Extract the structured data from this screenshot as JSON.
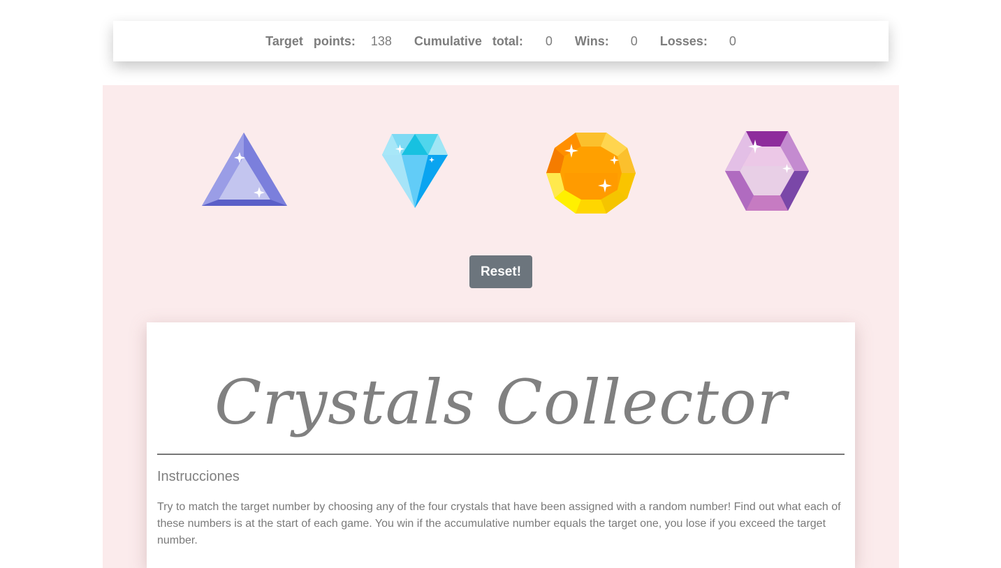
{
  "scoreboard": {
    "target_label": "Target points:",
    "target_value": "138",
    "cumulative_label": "Cumulative total:",
    "cumulative_value": "0",
    "wins_label": "Wins:",
    "wins_value": "0",
    "losses_label": "Losses:",
    "losses_value": "0"
  },
  "crystals": [
    {
      "icon": "triangle-crystal-icon",
      "color": "#8b8fd9"
    },
    {
      "icon": "diamond-crystal-icon",
      "color": "#5ec8f2"
    },
    {
      "icon": "orange-round-crystal-icon",
      "color": "#f5a623"
    },
    {
      "icon": "purple-hexagon-crystal-icon",
      "color": "#a45fb5"
    }
  ],
  "reset_label": "Reset!",
  "card": {
    "title": "Crystals Collector",
    "subheading": "Instrucciones",
    "instructions": "Try to match the target number by choosing any of the four crystals that have been assigned with a random number! Find out what each of these numbers is at the start of each game. You win if the accumulative number equals the target one, you lose if you exceed the target number."
  },
  "colors": {
    "stage_bg": "#fbebec",
    "button_bg": "#6c757d",
    "text": "#7a7a7a"
  }
}
